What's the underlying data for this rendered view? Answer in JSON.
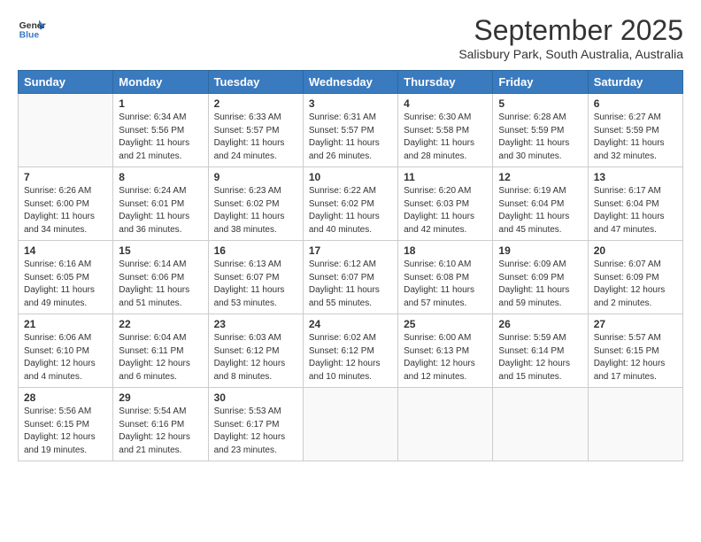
{
  "header": {
    "logo_general": "General",
    "logo_blue": "Blue",
    "month_title": "September 2025",
    "subtitle": "Salisbury Park, South Australia, Australia"
  },
  "days_of_week": [
    "Sunday",
    "Monday",
    "Tuesday",
    "Wednesday",
    "Thursday",
    "Friday",
    "Saturday"
  ],
  "weeks": [
    [
      {
        "day": "",
        "info": ""
      },
      {
        "day": "1",
        "info": "Sunrise: 6:34 AM\nSunset: 5:56 PM\nDaylight: 11 hours\nand 21 minutes."
      },
      {
        "day": "2",
        "info": "Sunrise: 6:33 AM\nSunset: 5:57 PM\nDaylight: 11 hours\nand 24 minutes."
      },
      {
        "day": "3",
        "info": "Sunrise: 6:31 AM\nSunset: 5:57 PM\nDaylight: 11 hours\nand 26 minutes."
      },
      {
        "day": "4",
        "info": "Sunrise: 6:30 AM\nSunset: 5:58 PM\nDaylight: 11 hours\nand 28 minutes."
      },
      {
        "day": "5",
        "info": "Sunrise: 6:28 AM\nSunset: 5:59 PM\nDaylight: 11 hours\nand 30 minutes."
      },
      {
        "day": "6",
        "info": "Sunrise: 6:27 AM\nSunset: 5:59 PM\nDaylight: 11 hours\nand 32 minutes."
      }
    ],
    [
      {
        "day": "7",
        "info": "Sunrise: 6:26 AM\nSunset: 6:00 PM\nDaylight: 11 hours\nand 34 minutes."
      },
      {
        "day": "8",
        "info": "Sunrise: 6:24 AM\nSunset: 6:01 PM\nDaylight: 11 hours\nand 36 minutes."
      },
      {
        "day": "9",
        "info": "Sunrise: 6:23 AM\nSunset: 6:02 PM\nDaylight: 11 hours\nand 38 minutes."
      },
      {
        "day": "10",
        "info": "Sunrise: 6:22 AM\nSunset: 6:02 PM\nDaylight: 11 hours\nand 40 minutes."
      },
      {
        "day": "11",
        "info": "Sunrise: 6:20 AM\nSunset: 6:03 PM\nDaylight: 11 hours\nand 42 minutes."
      },
      {
        "day": "12",
        "info": "Sunrise: 6:19 AM\nSunset: 6:04 PM\nDaylight: 11 hours\nand 45 minutes."
      },
      {
        "day": "13",
        "info": "Sunrise: 6:17 AM\nSunset: 6:04 PM\nDaylight: 11 hours\nand 47 minutes."
      }
    ],
    [
      {
        "day": "14",
        "info": "Sunrise: 6:16 AM\nSunset: 6:05 PM\nDaylight: 11 hours\nand 49 minutes."
      },
      {
        "day": "15",
        "info": "Sunrise: 6:14 AM\nSunset: 6:06 PM\nDaylight: 11 hours\nand 51 minutes."
      },
      {
        "day": "16",
        "info": "Sunrise: 6:13 AM\nSunset: 6:07 PM\nDaylight: 11 hours\nand 53 minutes."
      },
      {
        "day": "17",
        "info": "Sunrise: 6:12 AM\nSunset: 6:07 PM\nDaylight: 11 hours\nand 55 minutes."
      },
      {
        "day": "18",
        "info": "Sunrise: 6:10 AM\nSunset: 6:08 PM\nDaylight: 11 hours\nand 57 minutes."
      },
      {
        "day": "19",
        "info": "Sunrise: 6:09 AM\nSunset: 6:09 PM\nDaylight: 11 hours\nand 59 minutes."
      },
      {
        "day": "20",
        "info": "Sunrise: 6:07 AM\nSunset: 6:09 PM\nDaylight: 12 hours\nand 2 minutes."
      }
    ],
    [
      {
        "day": "21",
        "info": "Sunrise: 6:06 AM\nSunset: 6:10 PM\nDaylight: 12 hours\nand 4 minutes."
      },
      {
        "day": "22",
        "info": "Sunrise: 6:04 AM\nSunset: 6:11 PM\nDaylight: 12 hours\nand 6 minutes."
      },
      {
        "day": "23",
        "info": "Sunrise: 6:03 AM\nSunset: 6:12 PM\nDaylight: 12 hours\nand 8 minutes."
      },
      {
        "day": "24",
        "info": "Sunrise: 6:02 AM\nSunset: 6:12 PM\nDaylight: 12 hours\nand 10 minutes."
      },
      {
        "day": "25",
        "info": "Sunrise: 6:00 AM\nSunset: 6:13 PM\nDaylight: 12 hours\nand 12 minutes."
      },
      {
        "day": "26",
        "info": "Sunrise: 5:59 AM\nSunset: 6:14 PM\nDaylight: 12 hours\nand 15 minutes."
      },
      {
        "day": "27",
        "info": "Sunrise: 5:57 AM\nSunset: 6:15 PM\nDaylight: 12 hours\nand 17 minutes."
      }
    ],
    [
      {
        "day": "28",
        "info": "Sunrise: 5:56 AM\nSunset: 6:15 PM\nDaylight: 12 hours\nand 19 minutes."
      },
      {
        "day": "29",
        "info": "Sunrise: 5:54 AM\nSunset: 6:16 PM\nDaylight: 12 hours\nand 21 minutes."
      },
      {
        "day": "30",
        "info": "Sunrise: 5:53 AM\nSunset: 6:17 PM\nDaylight: 12 hours\nand 23 minutes."
      },
      {
        "day": "",
        "info": ""
      },
      {
        "day": "",
        "info": ""
      },
      {
        "day": "",
        "info": ""
      },
      {
        "day": "",
        "info": ""
      }
    ]
  ]
}
